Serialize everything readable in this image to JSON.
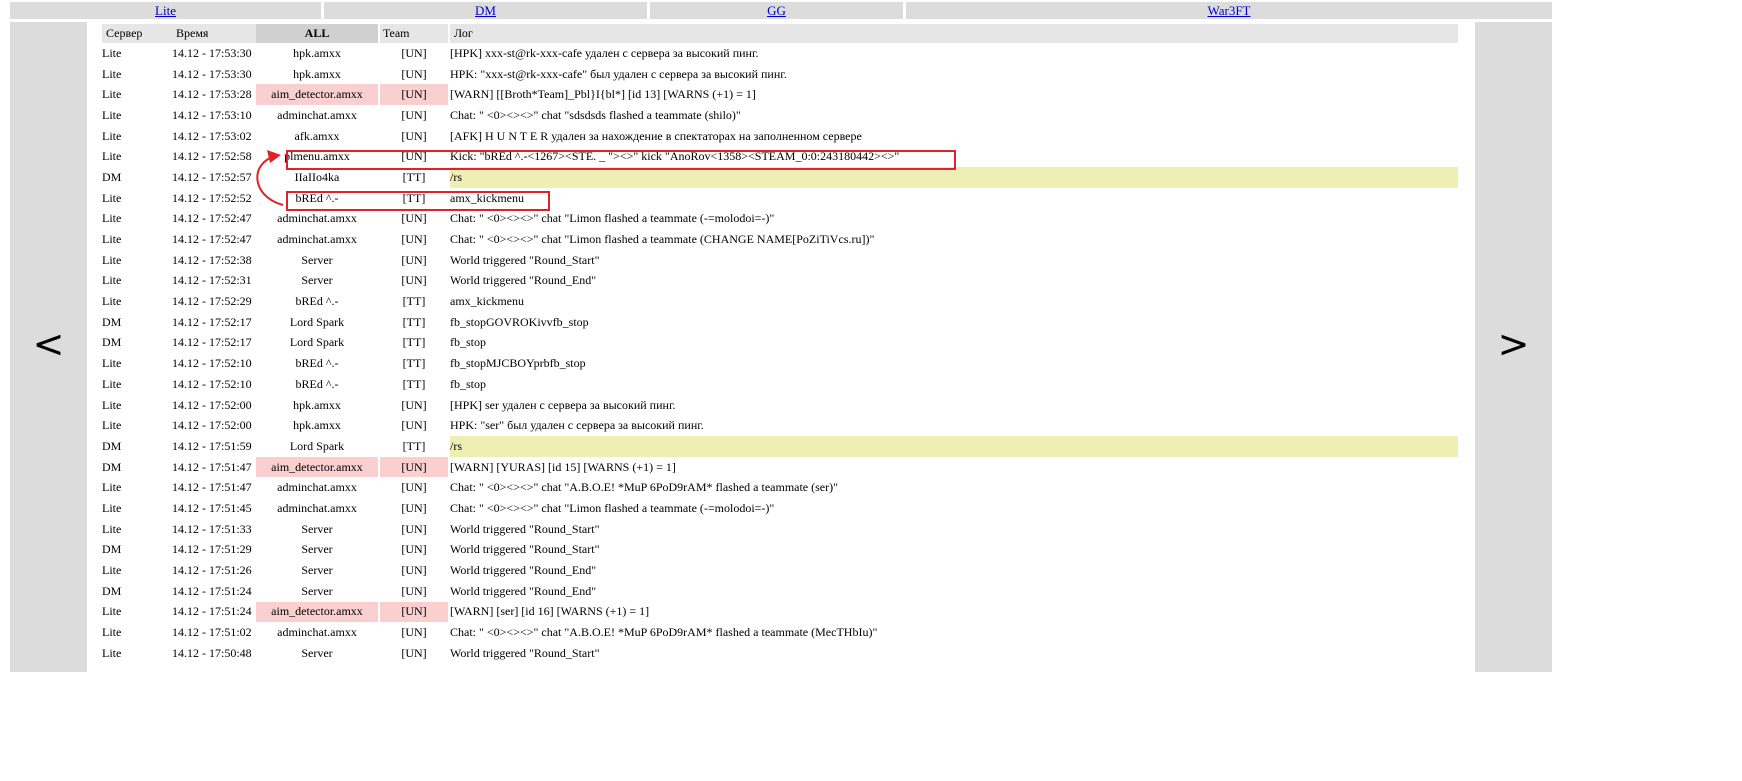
{
  "tabs": [
    "Lite",
    "DM",
    "GG",
    "War3FT"
  ],
  "nav": {
    "prev": "<",
    "next": ">"
  },
  "headers": {
    "server": "Сервер",
    "time": "Время",
    "all": "ALL",
    "team": "Team",
    "log": "Лог"
  },
  "colors": {
    "pink_highlight": "#f9cfcf",
    "yellow_highlight": "#efefb4",
    "annotation_red": "#e0202a"
  },
  "rows": [
    {
      "server": "Lite",
      "time": "14.12 - 17:53:30",
      "plugin": "hpk.amxx",
      "team": "[UN]",
      "log": "[HPK] xxx-st@rk-xxx-cafe удален с сервера за высокий пинг.",
      "hl": ""
    },
    {
      "server": "Lite",
      "time": "14.12 - 17:53:30",
      "plugin": "hpk.amxx",
      "team": "[UN]",
      "log": "HPK: \"xxx-st@rk-xxx-cafe\" был удален с сервера за высокий пинг.",
      "hl": ""
    },
    {
      "server": "Lite",
      "time": "14.12 - 17:53:28",
      "plugin": "aim_detector.amxx",
      "team": "[UN]",
      "log": "[WARN] [[Broth*Team]_Pbl}I{bl*] [id 13] [WARNS (+1) = 1]",
      "hl": "pink"
    },
    {
      "server": "Lite",
      "time": "14.12 - 17:53:10",
      "plugin": "adminchat.amxx",
      "team": "[UN]",
      "log": "Chat: \"                              <0><><>\" chat \"sdsdsds flashed a teammate (shilo)\"",
      "hl": ""
    },
    {
      "server": "Lite",
      "time": "14.12 - 17:53:02",
      "plugin": "afk.amxx",
      "team": "[UN]",
      "log": "[AFK] H U N T E R удален за нахождение в спектаторах на заполненном сервере",
      "hl": ""
    },
    {
      "server": "Lite",
      "time": "14.12 - 17:52:58",
      "plugin": "plmenu.amxx",
      "team": "[UN]",
      "log": "Kick: \"bREd ^.-<1267><STE.          _                  \"><>\" kick \"AnoRov<1358><STEAM_0:0:243180442><>\"",
      "hl": ""
    },
    {
      "server": "DM",
      "time": "14.12 - 17:52:57",
      "plugin": "IIaIIo4ka",
      "team": "[TT]",
      "log": "/rs",
      "hl": "yellow"
    },
    {
      "server": "Lite",
      "time": "14.12 - 17:52:52",
      "plugin": "bREd ^.-",
      "team": "[TT]",
      "log": "amx_kickmenu",
      "hl": ""
    },
    {
      "server": "Lite",
      "time": "14.12 - 17:52:47",
      "plugin": "adminchat.amxx",
      "team": "[UN]",
      "log": "Chat: \"                              <0><><>\" chat \"Limon flashed a teammate (-=molodoi=-)\"",
      "hl": ""
    },
    {
      "server": "Lite",
      "time": "14.12 - 17:52:47",
      "plugin": "adminchat.amxx",
      "team": "[UN]",
      "log": "Chat: \"                              <0><><>\" chat \"Limon flashed a teammate (CHANGE NAME[PoZiTiVcs.ru])\"",
      "hl": ""
    },
    {
      "server": "Lite",
      "time": "14.12 - 17:52:38",
      "plugin": "Server",
      "team": "[UN]",
      "log": "World triggered \"Round_Start\"",
      "hl": ""
    },
    {
      "server": "Lite",
      "time": "14.12 - 17:52:31",
      "plugin": "Server",
      "team": "[UN]",
      "log": "World triggered \"Round_End\"",
      "hl": ""
    },
    {
      "server": "Lite",
      "time": "14.12 - 17:52:29",
      "plugin": "bREd ^.-",
      "team": "[TT]",
      "log": "amx_kickmenu",
      "hl": ""
    },
    {
      "server": "DM",
      "time": "14.12 - 17:52:17",
      "plugin": "Lord Spark",
      "team": "[TT]",
      "log": "fb_stopGOVROKivvfb_stop",
      "hl": ""
    },
    {
      "server": "DM",
      "time": "14.12 - 17:52:17",
      "plugin": "Lord Spark",
      "team": "[TT]",
      "log": "fb_stop",
      "hl": ""
    },
    {
      "server": "Lite",
      "time": "14.12 - 17:52:10",
      "plugin": "bREd ^.-",
      "team": "[TT]",
      "log": "fb_stopMJCBOYprbfb_stop",
      "hl": ""
    },
    {
      "server": "Lite",
      "time": "14.12 - 17:52:10",
      "plugin": "bREd ^.-",
      "team": "[TT]",
      "log": "fb_stop",
      "hl": ""
    },
    {
      "server": "Lite",
      "time": "14.12 - 17:52:00",
      "plugin": "hpk.amxx",
      "team": "[UN]",
      "log": "[HPK] ser удален с сервера за высокий пинг.",
      "hl": ""
    },
    {
      "server": "Lite",
      "time": "14.12 - 17:52:00",
      "plugin": "hpk.amxx",
      "team": "[UN]",
      "log": "HPK: \"ser\" был удален с сервера за высокий пинг.",
      "hl": ""
    },
    {
      "server": "DM",
      "time": "14.12 - 17:51:59",
      "plugin": "Lord Spark",
      "team": "[TT]",
      "log": "/rs",
      "hl": "yellow"
    },
    {
      "server": "DM",
      "time": "14.12 - 17:51:47",
      "plugin": "aim_detector.amxx",
      "team": "[UN]",
      "log": "[WARN] [YURAS] [id 15] [WARNS (+1) = 1]",
      "hl": "pink"
    },
    {
      "server": "Lite",
      "time": "14.12 - 17:51:47",
      "plugin": "adminchat.amxx",
      "team": "[UN]",
      "log": "Chat: \"                              <0><><>\" chat \"A.B.O.E! *MuP 6PoD9rAM* flashed a teammate (ser)\"",
      "hl": ""
    },
    {
      "server": "Lite",
      "time": "14.12 - 17:51:45",
      "plugin": "adminchat.amxx",
      "team": "[UN]",
      "log": "Chat: \"                              <0><><>\" chat \"Limon flashed a teammate (-=molodoi=-)\"",
      "hl": ""
    },
    {
      "server": "Lite",
      "time": "14.12 - 17:51:33",
      "plugin": "Server",
      "team": "[UN]",
      "log": "World triggered \"Round_Start\"",
      "hl": ""
    },
    {
      "server": "DM",
      "time": "14.12 - 17:51:29",
      "plugin": "Server",
      "team": "[UN]",
      "log": "World triggered \"Round_Start\"",
      "hl": ""
    },
    {
      "server": "Lite",
      "time": "14.12 - 17:51:26",
      "plugin": "Server",
      "team": "[UN]",
      "log": "World triggered \"Round_End\"",
      "hl": ""
    },
    {
      "server": "DM",
      "time": "14.12 - 17:51:24",
      "plugin": "Server",
      "team": "[UN]",
      "log": "World triggered \"Round_End\"",
      "hl": ""
    },
    {
      "server": "Lite",
      "time": "14.12 - 17:51:24",
      "plugin": "aim_detector.amxx",
      "team": "[UN]",
      "log": "[WARN] [ser] [id 16] [WARNS (+1) = 1]",
      "hl": "pink"
    },
    {
      "server": "Lite",
      "time": "14.12 - 17:51:02",
      "plugin": "adminchat.amxx",
      "team": "[UN]",
      "log": "Chat: \"                              <0><><>\" chat \"A.B.O.E! *MuP 6PoD9rAM* flashed a teammate (MecTHbIu)\"",
      "hl": ""
    },
    {
      "server": "Lite",
      "time": "14.12 - 17:50:48",
      "plugin": "Server",
      "team": "[UN]",
      "log": "World triggered \"Round_Start\"",
      "hl": ""
    }
  ]
}
